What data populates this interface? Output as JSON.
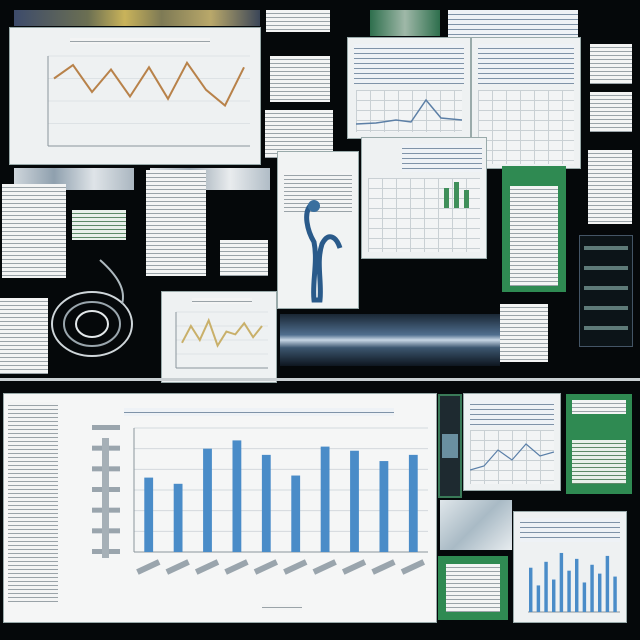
{
  "chart_data": {
    "type": "bar",
    "categories": [
      "",
      "",
      "",
      "",
      "",
      "",
      "",
      "",
      "",
      ""
    ],
    "values": [
      36,
      33,
      50,
      54,
      47,
      37,
      51,
      49,
      44,
      47
    ],
    "ylim": [
      0,
      60
    ],
    "grid": true,
    "legend": "none",
    "bar_color": "#4a8cc8"
  },
  "line_chart_top": {
    "values": [
      30,
      36,
      24,
      34,
      22,
      35,
      21,
      37,
      25,
      18,
      35
    ],
    "line_color": "#b8824a"
  },
  "line_chart_mid": {
    "values": [
      18,
      30,
      20,
      34,
      16,
      26,
      24,
      32,
      22,
      30
    ],
    "line_color": "#c9b06a"
  },
  "colors": {
    "background": "#05080a",
    "panel": "#eef1f2",
    "accent_green": "#2f8a52",
    "accent_blue": "#4a8cc8"
  }
}
